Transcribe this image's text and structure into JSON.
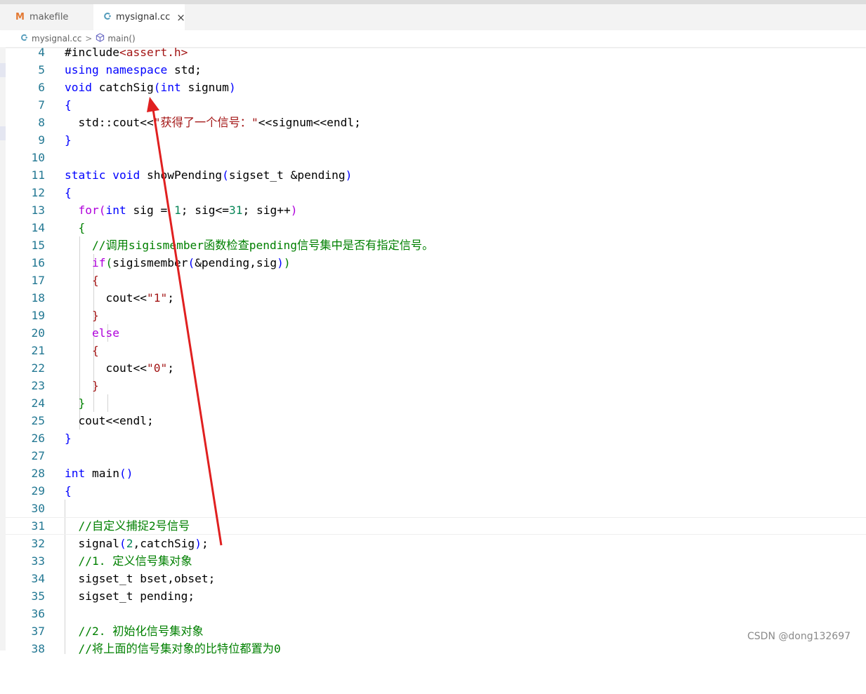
{
  "tabs": [
    {
      "icon": "M",
      "label": "makefile"
    },
    {
      "icon": "C",
      "label": "mysignal.cc",
      "close": "×"
    }
  ],
  "breadcrumb": {
    "file": "mysignal.cc",
    "separator": ">",
    "symbol": "main()"
  },
  "code_lines": [
    {
      "num": "4",
      "html": "#include<span class=\"str\">&lt;assert.h&gt;</span>"
    },
    {
      "num": "5",
      "html": "<span class=\"kw\">using</span> <span class=\"kw\">namespace</span> std;"
    },
    {
      "num": "6",
      "html": "<span class=\"kw\">void</span> catchSig<span class=\"kw\">(</span><span class=\"kw\">int</span> signum<span class=\"kw\">)</span>"
    },
    {
      "num": "7",
      "html": "<span class=\"kw\">{</span>"
    },
    {
      "num": "8",
      "html": "  std::cout&lt;&lt;<span class=\"str\">\"获得了一个信号：\"</span>&lt;&lt;signum&lt;&lt;endl;"
    },
    {
      "num": "9",
      "html": "<span class=\"kw\">}</span>"
    },
    {
      "num": "10",
      "html": ""
    },
    {
      "num": "11",
      "html": "<span class=\"kw\">static</span> <span class=\"kw\">void</span> showPending<span class=\"kw\">(</span>sigset_t &amp;pending<span class=\"kw\">)</span>"
    },
    {
      "num": "12",
      "html": "<span class=\"kw\">{</span>"
    },
    {
      "num": "13",
      "html": "  <span class=\"ctl\">for</span><span class=\"ctl\">(</span><span class=\"kw\">int</span> sig = <span class=\"num\">1</span>; sig&lt;=<span class=\"num\">31</span>; sig++<span class=\"ctl\">)</span>"
    },
    {
      "num": "14",
      "html": "  <span class=\"com\">{</span>"
    },
    {
      "num": "15",
      "html": "    <span class=\"com\">//调用sigismember函数检查pending信号集中是否有指定信号。</span>"
    },
    {
      "num": "16",
      "html": "    <span class=\"ctl\">if</span><span class=\"com\">(</span>sigismember<span class=\"kw\">(</span>&amp;pending,sig<span class=\"kw\">)</span><span class=\"com\">)</span>"
    },
    {
      "num": "17",
      "html": "    <span class=\"str\">{</span>"
    },
    {
      "num": "18",
      "html": "      cout&lt;&lt;<span class=\"str\">\"1\"</span>;"
    },
    {
      "num": "19",
      "html": "    <span class=\"str\">}</span>"
    },
    {
      "num": "20",
      "html": "    <span class=\"ctl\">else</span>"
    },
    {
      "num": "21",
      "html": "    <span class=\"str\">{</span>"
    },
    {
      "num": "22",
      "html": "      cout&lt;&lt;<span class=\"str\">\"0\"</span>;"
    },
    {
      "num": "23",
      "html": "    <span class=\"str\">}</span>"
    },
    {
      "num": "24",
      "html": "  <span class=\"com\">}</span>"
    },
    {
      "num": "25",
      "html": "  cout&lt;&lt;endl;"
    },
    {
      "num": "26",
      "html": "<span class=\"kw\">}</span>"
    },
    {
      "num": "27",
      "html": ""
    },
    {
      "num": "28",
      "html": "<span class=\"kw\">int</span> main<span class=\"kw\">()</span>"
    },
    {
      "num": "29",
      "html": "<span class=\"kw\">{</span>"
    },
    {
      "num": "30",
      "html": ""
    },
    {
      "num": "31",
      "html": "  <span class=\"com\">//自定义捕捉2号信号</span>"
    },
    {
      "num": "32",
      "html": "  signal<span class=\"kw\">(</span><span class=\"num\">2</span>,catchSig<span class=\"kw\">)</span>;"
    },
    {
      "num": "33",
      "html": "  <span class=\"com\">//1. 定义信号集对象</span>"
    },
    {
      "num": "34",
      "html": "  sigset_t bset,obset;"
    },
    {
      "num": "35",
      "html": "  sigset_t pending;"
    },
    {
      "num": "36",
      "html": ""
    },
    {
      "num": "37",
      "html": "  <span class=\"com\">//2. 初始化信号集对象</span>"
    },
    {
      "num": "38",
      "html": "  <span class=\"com\">//将上面的信号集对象的比特位都置为0</span>"
    }
  ],
  "annotation": {
    "color": "#e02020"
  },
  "watermark": "CSDN @dong132697"
}
